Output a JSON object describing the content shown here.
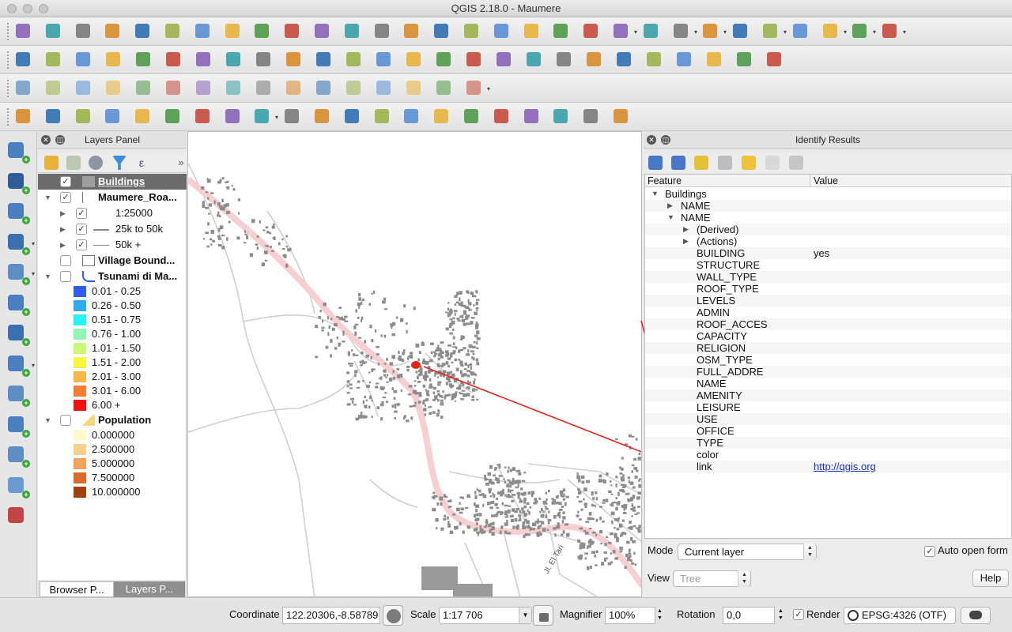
{
  "window": {
    "title": "QGIS 2.18.0 - Maumere"
  },
  "layers_panel": {
    "title": "Layers Panel",
    "layers": [
      {
        "label": "Buildings",
        "checked": true,
        "selected": true
      },
      {
        "label": "Maumere_Roa...",
        "checked": true
      },
      {
        "label": "1:25000",
        "checked": true
      },
      {
        "label": "25k to 50k",
        "checked": true
      },
      {
        "label": "50k +",
        "checked": true
      },
      {
        "label": "Village Bound...",
        "checked": false
      },
      {
        "label": "Tsunami di Ma...",
        "checked": false
      },
      {
        "label": "Population",
        "checked": false
      }
    ],
    "tsunami_classes": [
      {
        "label": "0.01 - 0.25",
        "color": "#2f5cf5"
      },
      {
        "label": "0.26 - 0.50",
        "color": "#2fa9f2"
      },
      {
        "label": "0.51 - 0.75",
        "color": "#28f2f2"
      },
      {
        "label": "0.76 - 1.00",
        "color": "#8ff7b4"
      },
      {
        "label": "1.01 - 1.50",
        "color": "#c9f878"
      },
      {
        "label": "1.51 - 2.00",
        "color": "#f6f73a"
      },
      {
        "label": "2.01 - 3.00",
        "color": "#f9b548"
      },
      {
        "label": "3.01 - 6.00",
        "color": "#f77a35"
      },
      {
        "label": "6.00 +",
        "color": "#f50f0f"
      }
    ],
    "population_classes": [
      {
        "label": "0.000000",
        "color": "#fefac9"
      },
      {
        "label": "2.500000",
        "color": "#f9d08c"
      },
      {
        "label": "5.000000",
        "color": "#f2a25a"
      },
      {
        "label": "7.500000",
        "color": "#de6b2c"
      },
      {
        "label": "10.000000",
        "color": "#a0400f"
      }
    ],
    "tabs": [
      "Browser P...",
      "Layers P..."
    ]
  },
  "identify_panel": {
    "title": "Identify Results",
    "columns": {
      "feature": "Feature",
      "value": "Value"
    },
    "rows": [
      {
        "feature": "Buildings",
        "value": "",
        "indent": 0,
        "expander": "open"
      },
      {
        "feature": "NAME",
        "value": "",
        "indent": 1,
        "expander": "closed"
      },
      {
        "feature": "NAME",
        "value": "",
        "indent": 1,
        "expander": "open"
      },
      {
        "feature": "(Derived)",
        "value": "",
        "indent": 2,
        "expander": "closed"
      },
      {
        "feature": "(Actions)",
        "value": "",
        "indent": 2,
        "expander": "closed"
      },
      {
        "feature": "BUILDING",
        "value": "yes",
        "indent": 2,
        "expander": ""
      },
      {
        "feature": "STRUCTURE",
        "value": "",
        "indent": 2,
        "expander": ""
      },
      {
        "feature": "WALL_TYPE",
        "value": "",
        "indent": 2,
        "expander": ""
      },
      {
        "feature": "ROOF_TYPE",
        "value": "",
        "indent": 2,
        "expander": ""
      },
      {
        "feature": "LEVELS",
        "value": "",
        "indent": 2,
        "expander": ""
      },
      {
        "feature": "ADMIN",
        "value": "",
        "indent": 2,
        "expander": ""
      },
      {
        "feature": "ROOF_ACCES",
        "value": "",
        "indent": 2,
        "expander": ""
      },
      {
        "feature": "CAPACITY",
        "value": "",
        "indent": 2,
        "expander": ""
      },
      {
        "feature": "RELIGION",
        "value": "",
        "indent": 2,
        "expander": ""
      },
      {
        "feature": "OSM_TYPE",
        "value": "",
        "indent": 2,
        "expander": ""
      },
      {
        "feature": "FULL_ADDRE",
        "value": "",
        "indent": 2,
        "expander": ""
      },
      {
        "feature": "NAME",
        "value": "",
        "indent": 2,
        "expander": ""
      },
      {
        "feature": "AMENITY",
        "value": "",
        "indent": 2,
        "expander": ""
      },
      {
        "feature": "LEISURE",
        "value": "",
        "indent": 2,
        "expander": ""
      },
      {
        "feature": "USE",
        "value": "",
        "indent": 2,
        "expander": ""
      },
      {
        "feature": "OFFICE",
        "value": "",
        "indent": 2,
        "expander": ""
      },
      {
        "feature": "TYPE",
        "value": "",
        "indent": 2,
        "expander": ""
      },
      {
        "feature": "color",
        "value": "",
        "indent": 2,
        "expander": ""
      },
      {
        "feature": "link",
        "value": "http://qgis.org",
        "indent": 2,
        "expander": "",
        "is_link": true
      }
    ],
    "mode_label": "Mode",
    "mode_value": "Current layer",
    "auto_open_label": "Auto open form",
    "view_label": "View",
    "view_value": "Tree",
    "help_label": "Help"
  },
  "map": {
    "road_label": "Jl. El Tari",
    "highlight_color": "#e8231a"
  },
  "status_bar": {
    "coordinate_label": "Coordinate",
    "coordinate_value": "122.20306,-8.58789",
    "scale_label": "Scale",
    "scale_value": "1:17 706",
    "magnifier_label": "Magnifier",
    "magnifier_value": "100%",
    "rotation_label": "Rotation",
    "rotation_value": "0,0",
    "render_label": "Render",
    "crs_value": "EPSG:4326 (OTF)"
  },
  "icons": {
    "file": [
      "new-project-icon",
      "open-project-icon",
      "save-project-icon",
      "save-as-icon",
      "new-print-composer-icon",
      "composer-manager-icon",
      "pan-icon",
      "pan-to-selection-icon",
      "zoom-in-icon",
      "zoom-out-icon",
      "zoom-native-icon",
      "zoom-full-icon",
      "zoom-to-selection-icon",
      "zoom-to-layer-icon",
      "zoom-last-icon",
      "zoom-next-icon",
      "new-bookmark-icon",
      "show-bookmarks-icon",
      "refresh-icon",
      "identify-icon",
      "select-icon",
      "select-by-rectangle-icon",
      "expression-icon",
      "deselect-icon",
      "attribute-table-icon",
      "field-calculator-icon",
      "statistics-icon",
      "measure-icon",
      "map-tips-icon",
      "text-annotation-icon"
    ],
    "digitize": [
      "edit-pencil-icon",
      "toggle-editing-icon",
      "save-edits-icon",
      "add-feature-icon",
      "node-tool-icon",
      "move-feature-icon",
      "delete-selected-icon",
      "cut-icon",
      "copy-icon",
      "paste-icon",
      "label-icon",
      "label-pin-icon",
      "label-highlight-icon",
      "show-hide-labels-icon",
      "move-label-icon",
      "rotate-label-icon",
      "change-label-icon",
      "label-settings-icon",
      "gps-icon",
      "python-icon",
      "plugin-manager-icon",
      "bug-icon",
      "processing-icon",
      "python-console-icon",
      "wfs-icon",
      "postgis-icon"
    ],
    "advanced": [
      "offset-curve-icon",
      "magnet-icon",
      "undo-icon",
      "redo-icon",
      "reshape-icon",
      "add-ring-icon",
      "add-part-icon",
      "fill-ring-icon",
      "delete-ring-icon",
      "delete-part-icon",
      "split-features-icon",
      "split-parts-icon",
      "merge-features-icon",
      "merge-attributes-icon",
      "rotate-point-symbols-icon",
      "offset-point-symbols-icon"
    ],
    "plugins": [
      "geometry-checker-icon",
      "rectangle-icon",
      "oriented-rect-icon",
      "magic-wand-icon",
      "magic-wand-2-icon",
      "georeferencer-icon",
      "raster-calc-icon",
      "heatmap-icon",
      "play-icon",
      "info-tool-icon",
      "info-tool-2-icon",
      "identify-tool-icon",
      "edit-tool-icon",
      "check-tool-icon",
      "grass-icon",
      "grass-tools-icon",
      "grid-icon",
      "grid-2-icon",
      "geometry-icon",
      "bookmark-icon",
      "tools-icon"
    ],
    "left": [
      "add-vector-layer-icon",
      "add-raster-layer-icon",
      "add-postgis-layer-icon",
      "add-spatialite-layer-icon",
      "add-mssql-layer-icon",
      "add-wms-layer-icon",
      "add-wcs-layer-icon",
      "add-wfs-layer-icon",
      "add-delimited-text-icon",
      "add-virtual-layer-icon",
      "new-shapefile-icon",
      "new-spatialite-layer-icon",
      "new-temp-layer-icon"
    ]
  }
}
